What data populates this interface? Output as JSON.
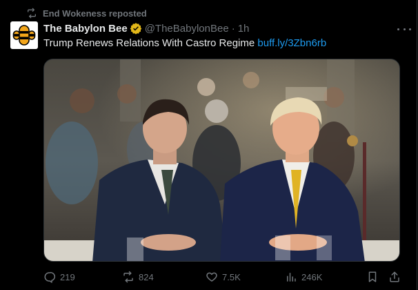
{
  "repost": {
    "text": "End Wokeness reposted",
    "icon": "repost-icon"
  },
  "author": {
    "name": "The Babylon Bee",
    "handle": "@TheBabylonBee",
    "separator": "·",
    "time": "1h",
    "verified_color": "#e2b719"
  },
  "tweet": {
    "text": "Trump Renews Relations With Castro Regime",
    "link": "buff.ly/3Zbn6rb"
  },
  "media": {
    "alt": "Photo of two men in suits seated at a restaurant table"
  },
  "actions": {
    "replies": "219",
    "reposts": "824",
    "likes": "7.5K",
    "views": "246K"
  },
  "colors": {
    "background": "#000000",
    "text": "#e7e9ea",
    "muted": "#71767b",
    "link": "#1d9bf0"
  }
}
